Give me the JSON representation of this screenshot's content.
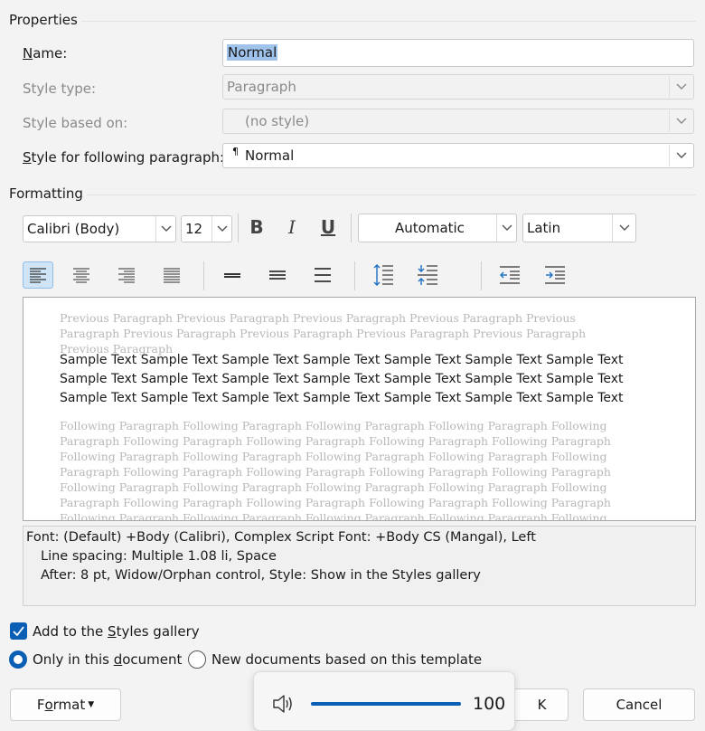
{
  "properties": {
    "title": "Properties",
    "name_label_pre": "",
    "name_label_u": "N",
    "name_label_post": "ame:",
    "name_value": "Normal",
    "style_type_label": "Style type:",
    "style_type_value": "Paragraph",
    "based_on_label": "Style based on:",
    "based_on_value": "(no style)",
    "following_label_u": "S",
    "following_label_post": "tyle for following paragraph:",
    "following_symbol": "¶",
    "following_value": "Normal"
  },
  "formatting": {
    "title": "Formatting",
    "font": "Calibri (Body)",
    "size": "12",
    "bold": "B",
    "italic": "I",
    "underline": "U",
    "color": "Automatic",
    "script": "Latin"
  },
  "preview": {
    "previous_text": "Previous Paragraph Previous Paragraph Previous Paragraph Previous Paragraph Previous Paragraph Previous Paragraph Previous Paragraph Previous Paragraph Previous Paragraph Previous Paragraph",
    "sample_text": "Sample Text Sample Text Sample Text Sample Text Sample Text Sample Text Sample Text Sample Text Sample Text Sample Text Sample Text Sample Text Sample Text Sample Text Sample Text Sample Text Sample Text Sample Text Sample Text Sample Text Sample Text",
    "following_text": "Following Paragraph Following Paragraph Following Paragraph Following Paragraph Following Paragraph Following Paragraph Following Paragraph Following Paragraph Following Paragraph Following Paragraph Following Paragraph Following Paragraph Following Paragraph Following Paragraph Following Paragraph Following Paragraph Following Paragraph Following Paragraph Following Paragraph Following Paragraph Following Paragraph Following Paragraph Following Paragraph Following Paragraph Following Paragraph Following Paragraph Following Paragraph Following Paragraph Following Paragraph Following Paragraph Following Paragraph Following Paragraph Following Paragraph Following Paragraph Following Paragraph"
  },
  "description": {
    "line1": "Font: (Default) +Body (Calibri), Complex Script Font: +Body CS (Mangal), Left",
    "line2": "Line spacing:  Multiple 1.08 li, Space",
    "line3": "After:  8 pt, Widow/Orphan control, Style: Show in the Styles gallery"
  },
  "options": {
    "add_gallery_pre": "Add to the ",
    "add_gallery_u": "S",
    "add_gallery_post": "tyles gallery",
    "only_doc_pre": "Only in this ",
    "only_doc_u": "d",
    "only_doc_post": "ocument",
    "new_docs": "New documents based on this template"
  },
  "buttons": {
    "format_pre": "F",
    "format_u": "o",
    "format_post": "rmat",
    "ok_visible": "K",
    "cancel": "Cancel"
  },
  "volume": {
    "level": 100,
    "level_text": "100"
  },
  "colors": {
    "accent": "#0a5fb4",
    "selection": "#9fc3eb"
  }
}
